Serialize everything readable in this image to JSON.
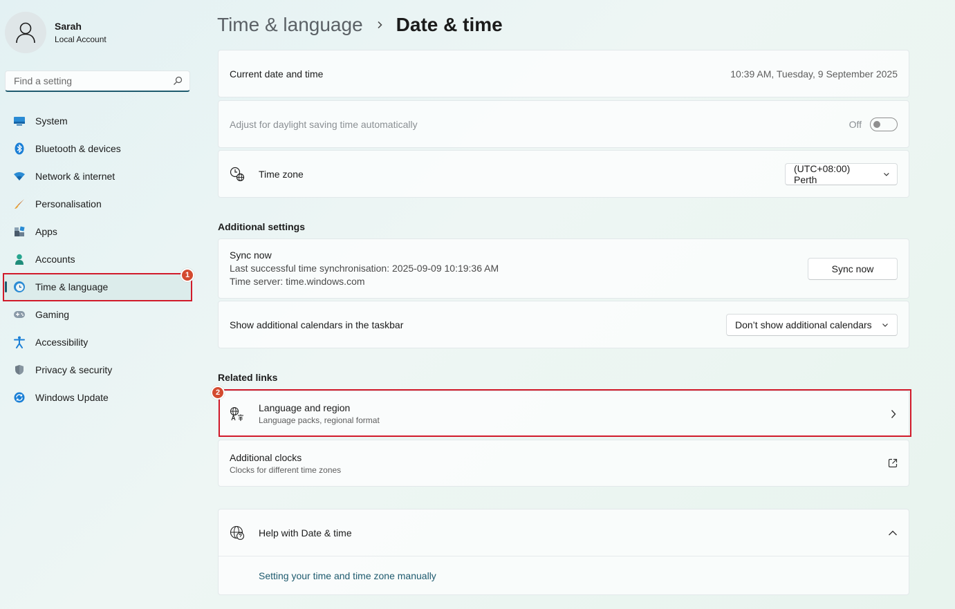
{
  "user": {
    "name": "Sarah",
    "account_type": "Local Account"
  },
  "search": {
    "placeholder": "Find a setting"
  },
  "sidebar": {
    "items": [
      {
        "label": "System",
        "icon": "system-icon"
      },
      {
        "label": "Bluetooth & devices",
        "icon": "bluetooth-icon"
      },
      {
        "label": "Network & internet",
        "icon": "network-icon"
      },
      {
        "label": "Personalisation",
        "icon": "brush-icon"
      },
      {
        "label": "Apps",
        "icon": "apps-icon"
      },
      {
        "label": "Accounts",
        "icon": "accounts-icon"
      },
      {
        "label": "Time & language",
        "icon": "time-language-icon",
        "active": true
      },
      {
        "label": "Gaming",
        "icon": "gaming-icon"
      },
      {
        "label": "Accessibility",
        "icon": "accessibility-icon"
      },
      {
        "label": "Privacy & security",
        "icon": "shield-icon"
      },
      {
        "label": "Windows Update",
        "icon": "update-icon"
      }
    ]
  },
  "breadcrumb": {
    "parent": "Time & language",
    "current": "Date & time"
  },
  "current_date": {
    "label": "Current date and time",
    "value": "10:39 AM, Tuesday, 9 September 2025"
  },
  "daylight": {
    "label": "Adjust for daylight saving time automatically",
    "state": "Off"
  },
  "timezone": {
    "label": "Time zone",
    "value": "(UTC+08:00) Perth"
  },
  "additional_settings": {
    "title": "Additional settings",
    "sync": {
      "title": "Sync now",
      "last_sync": "Last successful time synchronisation: 2025-09-09 10:19:36 AM",
      "server": "Time server: time.windows.com",
      "button": "Sync now"
    },
    "calendars": {
      "label": "Show additional calendars in the taskbar",
      "value": "Don’t show additional calendars"
    }
  },
  "related_links": {
    "title": "Related links",
    "language_region": {
      "title": "Language and region",
      "subtitle": "Language packs, regional format"
    },
    "additional_clocks": {
      "title": "Additional clocks",
      "subtitle": "Clocks for different time zones"
    }
  },
  "help": {
    "title": "Help with Date & time",
    "link": "Setting your time and time zone manually"
  },
  "annotations": {
    "badge1": "1",
    "badge2": "2"
  },
  "colors": {
    "accent": "#1e5a6e",
    "highlight": "#d11a2a",
    "badge": "#d34a2f"
  }
}
